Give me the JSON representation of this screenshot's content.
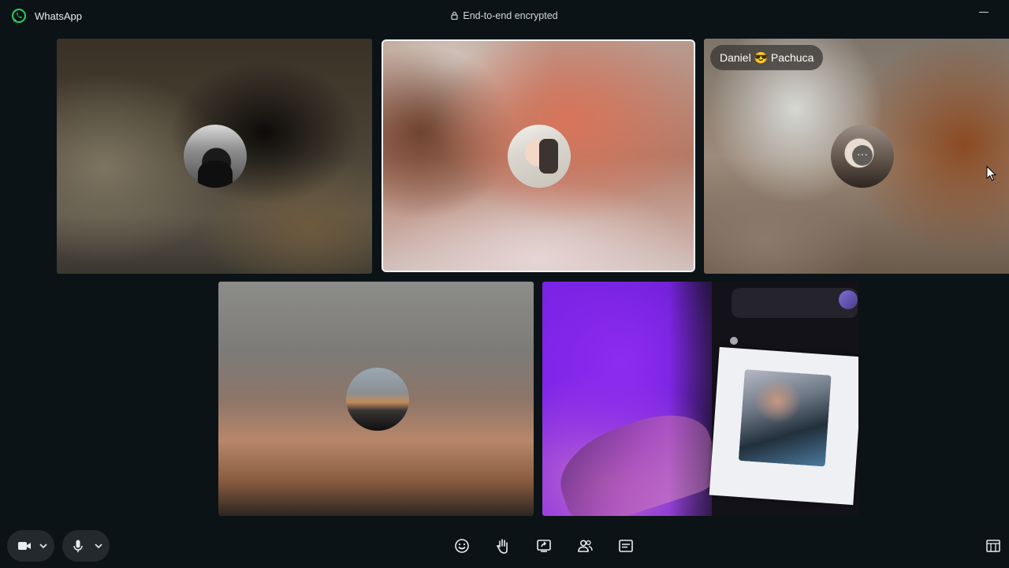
{
  "app": {
    "name": "WhatsApp",
    "encryption_label": "End-to-end encrypted"
  },
  "participants": [
    {
      "tile": 1,
      "name_tag": ""
    },
    {
      "tile": 2,
      "name_tag": "",
      "highlighted": true
    },
    {
      "tile": 3,
      "name_tag": "Daniel 😎 Pachuca"
    },
    {
      "tile": 4,
      "name_tag": ""
    },
    {
      "tile": 5,
      "name_tag": "",
      "video_on": true
    }
  ],
  "tile3": {
    "more_label": "···"
  },
  "controls": {
    "camera": {
      "icon": "video-camera-icon"
    },
    "microphone": {
      "icon": "microphone-icon"
    },
    "toolbar": [
      "emoji-reaction-icon",
      "raise-hand-icon",
      "share-screen-icon",
      "participants-icon",
      "captions-icon"
    ],
    "layout": {
      "icon": "layout-icon"
    }
  },
  "colors": {
    "background": "#0c1317",
    "accent": "#25d366",
    "control_bg": "#23292d"
  }
}
